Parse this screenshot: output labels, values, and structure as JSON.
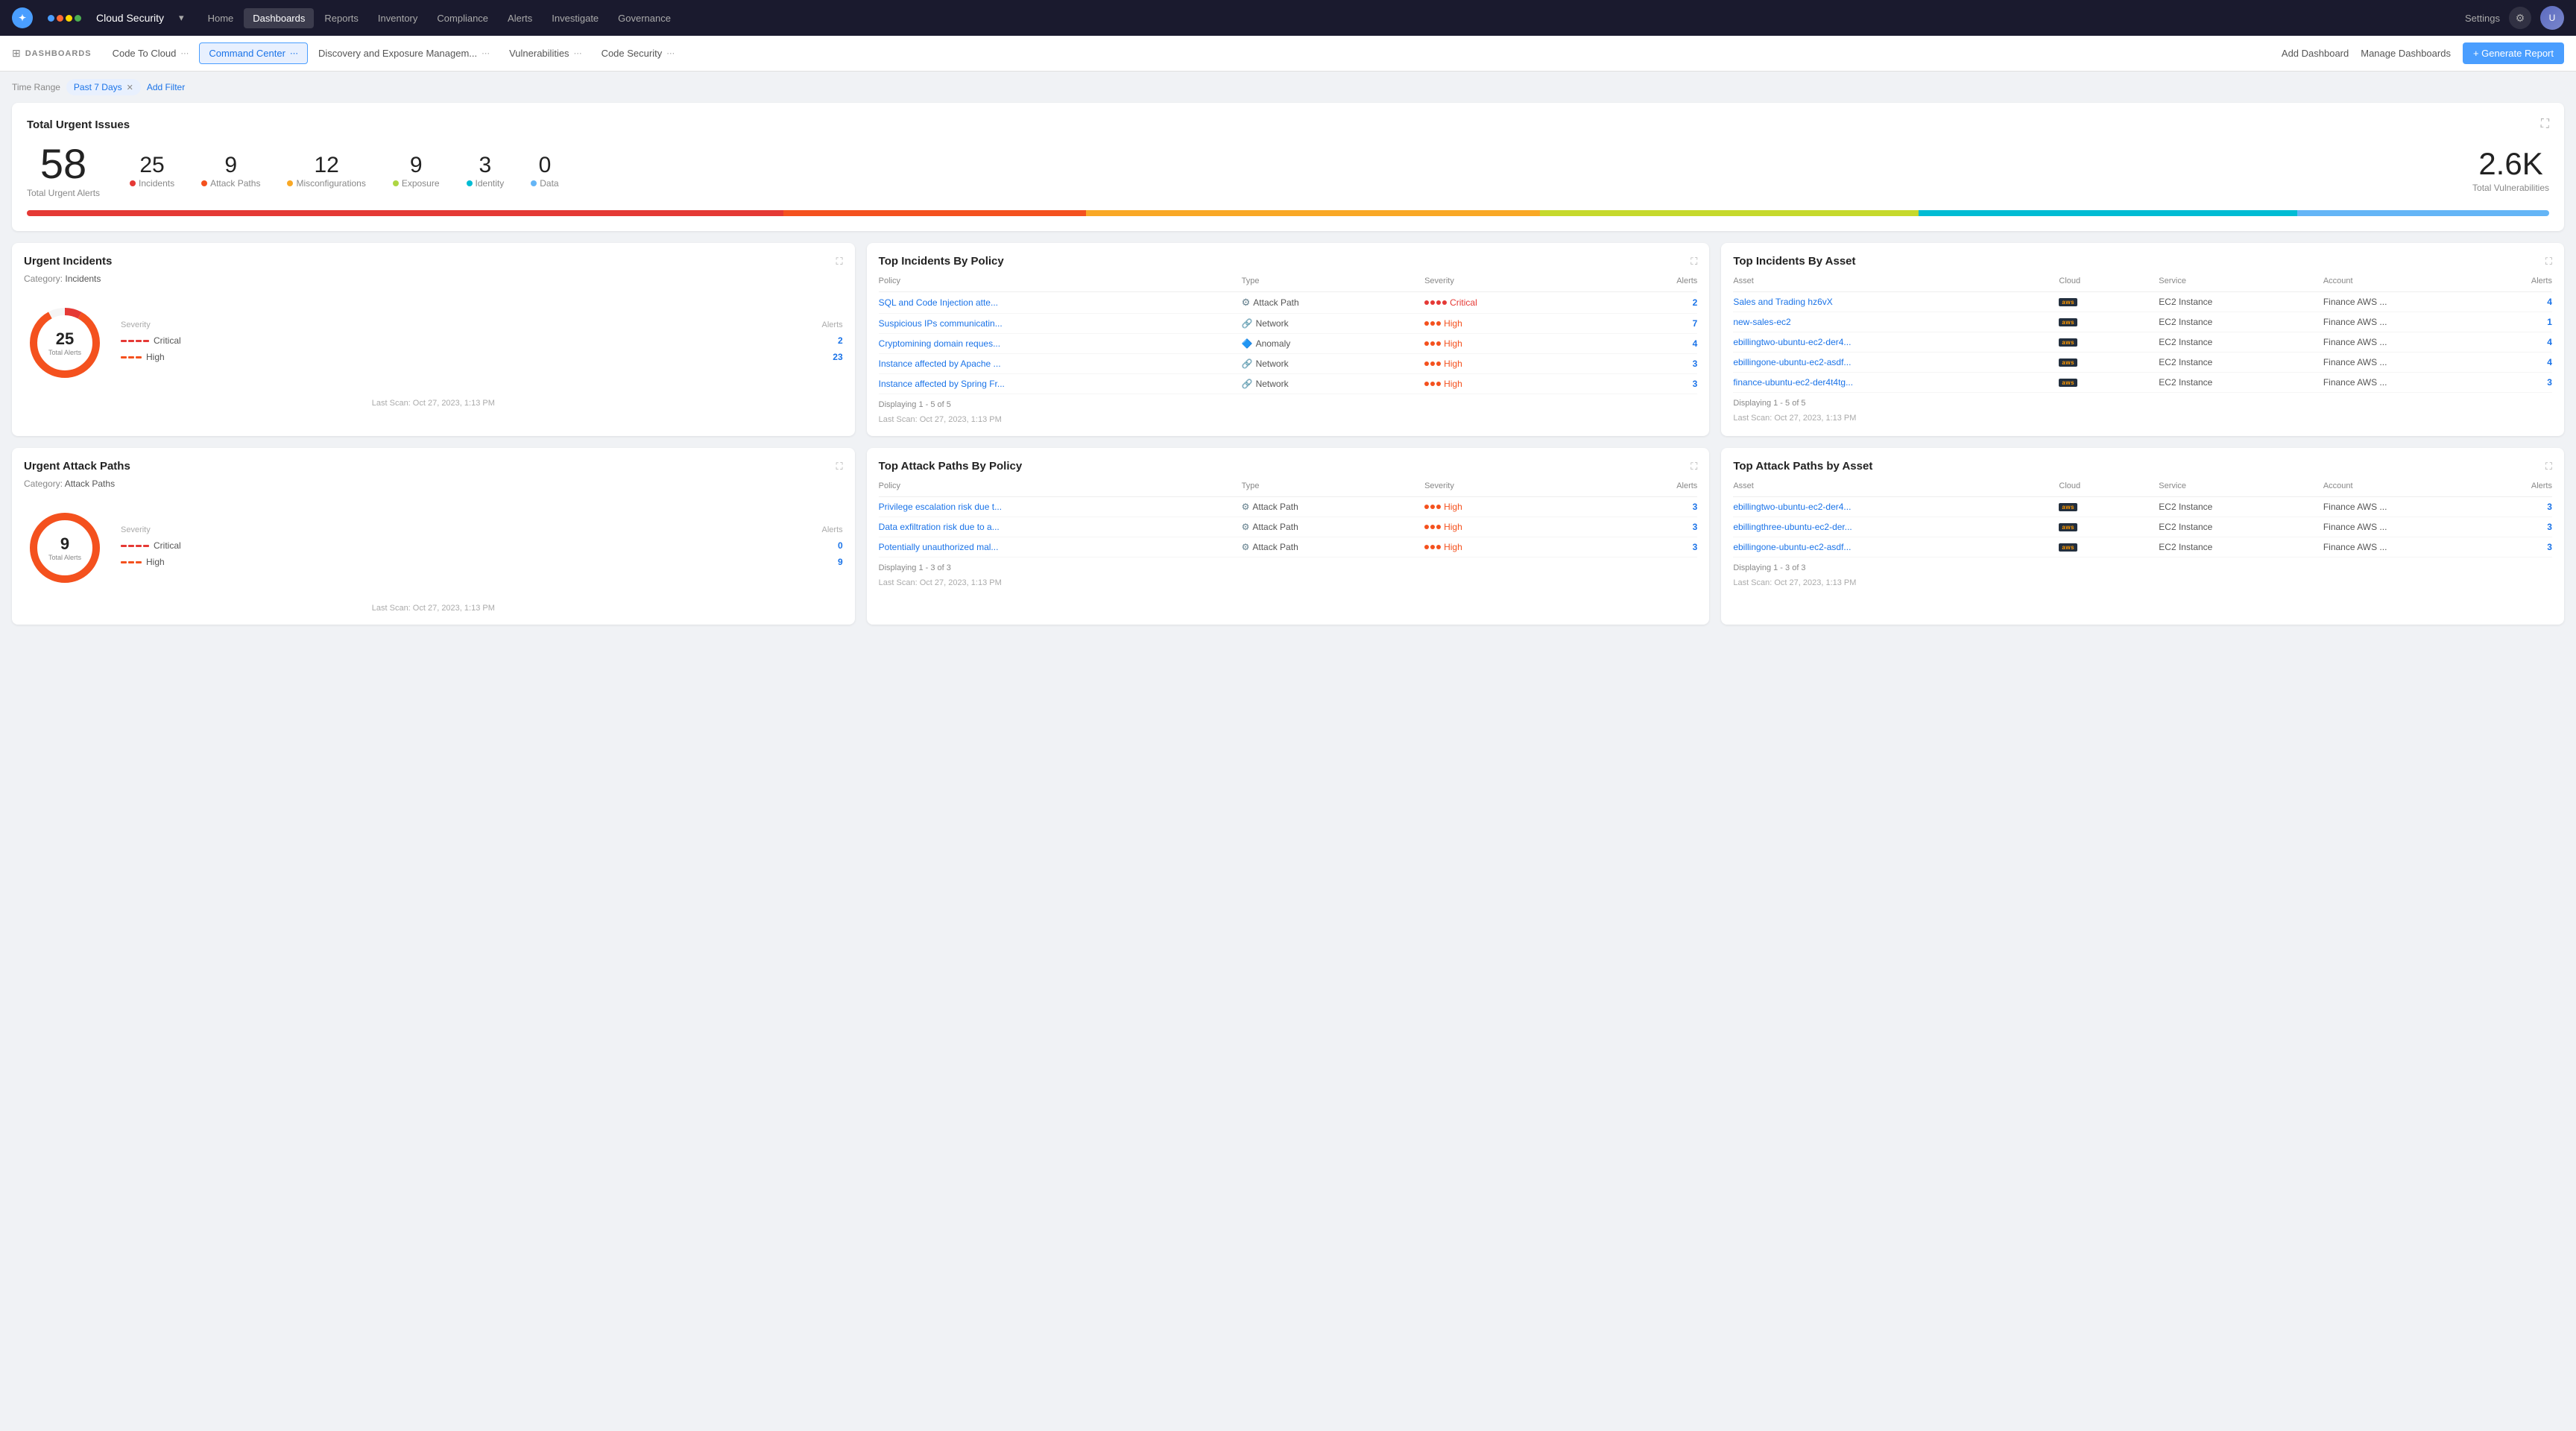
{
  "nav": {
    "logo_text": "Cloud Security",
    "links": [
      "Home",
      "Dashboards",
      "Reports",
      "Inventory",
      "Compliance",
      "Alerts",
      "Investigate",
      "Governance"
    ],
    "active_link": "Dashboards",
    "settings": "Settings",
    "right_icons": [
      "gear",
      "avatar"
    ]
  },
  "dashbar": {
    "label": "DASHBOARDS",
    "tabs": [
      {
        "id": "code-to-cloud",
        "label": "Code To Cloud"
      },
      {
        "id": "command-center",
        "label": "Command Center",
        "active": true
      },
      {
        "id": "discovery",
        "label": "Discovery and Exposure Managem..."
      },
      {
        "id": "vulnerabilities",
        "label": "Vulnerabilities"
      },
      {
        "id": "code-security",
        "label": "Code Security"
      }
    ],
    "add_dashboard": "Add Dashboard",
    "manage_dashboards": "Manage Dashboards",
    "generate_report": "+ Generate Report"
  },
  "filter": {
    "label": "Time Range",
    "chip": "Past 7 Days",
    "add_filter": "Add Filter"
  },
  "urgent_issues": {
    "title": "Total Urgent Issues",
    "total": "58",
    "total_label": "Total Urgent Alerts",
    "breakdown": [
      {
        "num": "25",
        "label": "Incidents",
        "color": "#e53935"
      },
      {
        "num": "9",
        "label": "Attack Paths",
        "color": "#f4511e"
      },
      {
        "num": "12",
        "label": "Misconfigurations",
        "color": "#f9a825"
      },
      {
        "num": "9",
        "label": "Exposure",
        "color": "#aed643"
      },
      {
        "num": "3",
        "label": "Identity",
        "color": "#00bcd4"
      },
      {
        "num": "0",
        "label": "Data",
        "color": "#64b5f6"
      }
    ],
    "vuln_total": "2.6K",
    "vuln_label": "Total Vulnerabilities",
    "progress_segments": [
      {
        "color": "#e53935",
        "pct": 30
      },
      {
        "color": "#f4511e",
        "pct": 12
      },
      {
        "color": "#f9a825",
        "pct": 18
      },
      {
        "color": "#aed643",
        "pct": 15
      },
      {
        "color": "#00bcd4",
        "pct": 15
      },
      {
        "color": "#64b5f6",
        "pct": 10
      }
    ]
  },
  "urgent_incidents": {
    "title": "Urgent Incidents",
    "category": "Incidents",
    "total": "25",
    "total_label": "Total Alerts",
    "severity": [
      {
        "label": "Critical",
        "count": "2",
        "color": "#e53935",
        "dashes": 4
      },
      {
        "label": "High",
        "count": "23",
        "color": "#f4511e",
        "dashes": 3
      }
    ],
    "last_scan": "Last Scan: Oct 27, 2023, 1:13 PM",
    "donut_segments": [
      {
        "color": "#e53935",
        "pct": 8
      },
      {
        "color": "#f4511e",
        "pct": 92
      }
    ]
  },
  "top_incidents_policy": {
    "title": "Top Incidents By Policy",
    "columns": [
      "Policy",
      "Type",
      "Severity",
      "Alerts"
    ],
    "rows": [
      {
        "policy": "SQL and Code Injection atte...",
        "type": "Attack Path",
        "type_icon": "⚙",
        "severity": "Critical",
        "severity_color": "#e53935",
        "alerts": "2"
      },
      {
        "policy": "Suspicious IPs communicatin...",
        "type": "Network",
        "type_icon": "🔗",
        "severity": "High",
        "severity_color": "#f4511e",
        "alerts": "7"
      },
      {
        "policy": "Cryptomining domain reques...",
        "type": "Anomaly",
        "type_icon": "🔷",
        "severity": "High",
        "severity_color": "#f4511e",
        "alerts": "4"
      },
      {
        "policy": "Instance affected by Apache ...",
        "type": "Network",
        "type_icon": "🔗",
        "severity": "High",
        "severity_color": "#f4511e",
        "alerts": "3"
      },
      {
        "policy": "Instance affected by Spring Fr...",
        "type": "Network",
        "type_icon": "🔗",
        "severity": "High",
        "severity_color": "#f4511e",
        "alerts": "3"
      }
    ],
    "displaying": "Displaying 1 - 5 of 5",
    "last_scan": "Last Scan: Oct 27, 2023, 1:13 PM"
  },
  "top_incidents_asset": {
    "title": "Top Incidents By Asset",
    "columns": [
      "Asset",
      "Cloud",
      "Service",
      "Account",
      "Alerts"
    ],
    "rows": [
      {
        "asset": "Sales and Trading hz6vX",
        "cloud": "aws",
        "service": "EC2 Instance",
        "account": "Finance AWS ...",
        "alerts": "4"
      },
      {
        "asset": "new-sales-ec2",
        "cloud": "aws",
        "service": "EC2 Instance",
        "account": "Finance AWS ...",
        "alerts": "1"
      },
      {
        "asset": "ebillingtwo-ubuntu-ec2-der4...",
        "cloud": "aws",
        "service": "EC2 Instance",
        "account": "Finance AWS ...",
        "alerts": "4"
      },
      {
        "asset": "ebillingone-ubuntu-ec2-asdf...",
        "cloud": "aws",
        "service": "EC2 Instance",
        "account": "Finance AWS ...",
        "alerts": "4"
      },
      {
        "asset": "finance-ubuntu-ec2-der4t4tg...",
        "cloud": "aws",
        "service": "EC2 Instance",
        "account": "Finance AWS ...",
        "alerts": "3"
      }
    ],
    "displaying": "Displaying 1 - 5 of 5",
    "last_scan": "Last Scan: Oct 27, 2023, 1:13 PM"
  },
  "urgent_attack_paths": {
    "title": "Urgent Attack Paths",
    "category": "Attack Paths",
    "total": "9",
    "total_label": "Total Alerts",
    "severity": [
      {
        "label": "Critical",
        "count": "0",
        "color": "#e53935",
        "dashes": 4
      },
      {
        "label": "High",
        "count": "9",
        "color": "#f4511e",
        "dashes": 3
      }
    ],
    "last_scan": "Last Scan: Oct 27, 2023, 1:13 PM",
    "donut_segments": [
      {
        "color": "#f4511e",
        "pct": 100
      }
    ]
  },
  "top_attack_paths_policy": {
    "title": "Top Attack Paths By Policy",
    "columns": [
      "Policy",
      "Type",
      "Severity",
      "Alerts"
    ],
    "rows": [
      {
        "policy": "Privilege escalation risk due t...",
        "type": "Attack Path",
        "type_icon": "⚙",
        "severity": "High",
        "severity_color": "#f4511e",
        "alerts": "3"
      },
      {
        "policy": "Data exfiltration risk due to a...",
        "type": "Attack Path",
        "type_icon": "⚙",
        "severity": "High",
        "severity_color": "#f4511e",
        "alerts": "3"
      },
      {
        "policy": "Potentially unauthorized mal...",
        "type": "Attack Path",
        "type_icon": "⚙",
        "severity": "High",
        "severity_color": "#f4511e",
        "alerts": "3"
      }
    ],
    "displaying": "Displaying 1 - 3 of 3",
    "last_scan": "Last Scan: Oct 27, 2023, 1:13 PM"
  },
  "top_attack_paths_asset": {
    "title": "Top Attack Paths by Asset",
    "columns": [
      "Asset",
      "Cloud",
      "Service",
      "Account",
      "Alerts"
    ],
    "rows": [
      {
        "asset": "ebillingtwo-ubuntu-ec2-der4...",
        "cloud": "aws",
        "service": "EC2 Instance",
        "account": "Finance AWS ...",
        "alerts": "3"
      },
      {
        "asset": "ebillingthree-ubuntu-ec2-der...",
        "cloud": "aws",
        "service": "EC2 Instance",
        "account": "Finance AWS ...",
        "alerts": "3"
      },
      {
        "asset": "ebillingone-ubuntu-ec2-asdf...",
        "cloud": "aws",
        "service": "EC2 Instance",
        "account": "Finance AWS ...",
        "alerts": "3"
      }
    ],
    "displaying": "Displaying 1 - 3 of 3",
    "last_scan": "Last Scan: Oct 27, 2023, 1:13 PM"
  }
}
